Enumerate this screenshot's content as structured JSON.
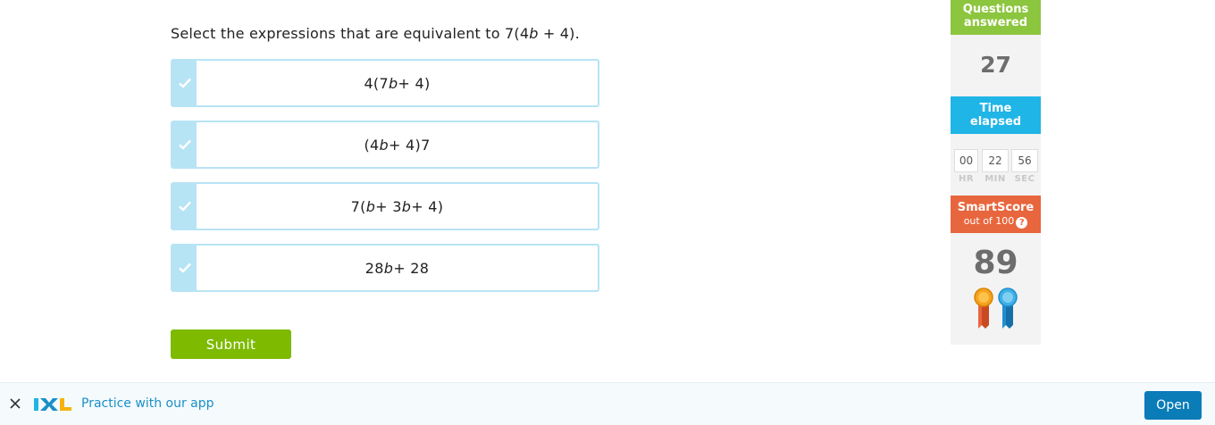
{
  "question": {
    "prefix": "Select the expressions that are equivalent to 7(4",
    "var": "b",
    "suffix": " + 4)."
  },
  "choices": [
    {
      "parts": [
        {
          "t": "4(7"
        },
        {
          "t": "b",
          "i": true
        },
        {
          "t": " + 4)"
        }
      ]
    },
    {
      "parts": [
        {
          "t": "(4"
        },
        {
          "t": "b",
          "i": true
        },
        {
          "t": " + 4)7"
        }
      ]
    },
    {
      "parts": [
        {
          "t": "7("
        },
        {
          "t": "b",
          "i": true
        },
        {
          "t": " + 3"
        },
        {
          "t": "b",
          "i": true
        },
        {
          "t": " + 4)"
        }
      ]
    },
    {
      "parts": [
        {
          "t": "28"
        },
        {
          "t": "b",
          "i": true
        },
        {
          "t": " + 28"
        }
      ]
    }
  ],
  "submit_label": "Submit",
  "sidebar": {
    "questions_answered_label_1": "Questions",
    "questions_answered_label_2": "answered",
    "questions_answered": "27",
    "time_elapsed_label_1": "Time",
    "time_elapsed_label_2": "elapsed",
    "timer": {
      "hr": "00",
      "min": "22",
      "sec": "56"
    },
    "timer_labels": {
      "hr": "HR",
      "min": "MIN",
      "sec": "SEC"
    },
    "smartscore_label": "SmartScore",
    "smartscore_sub": "out of 100",
    "help_glyph": "?",
    "smartscore": "89"
  },
  "banner": {
    "message": "Practice with our app",
    "open_label": "Open"
  },
  "colors": {
    "choice_border": "#b7e4f5",
    "submit": "#7dba00",
    "questions_answered": "#8cc63f",
    "time_elapsed": "#1fb5e6",
    "smartscore": "#e8663d",
    "open_button": "#0a7cb8"
  },
  "icons": {
    "check": "check-icon",
    "close": "close-icon",
    "logo": "ixl-logo",
    "ribbon_gold": "gold-ribbon-icon",
    "ribbon_blue": "blue-ribbon-icon"
  }
}
